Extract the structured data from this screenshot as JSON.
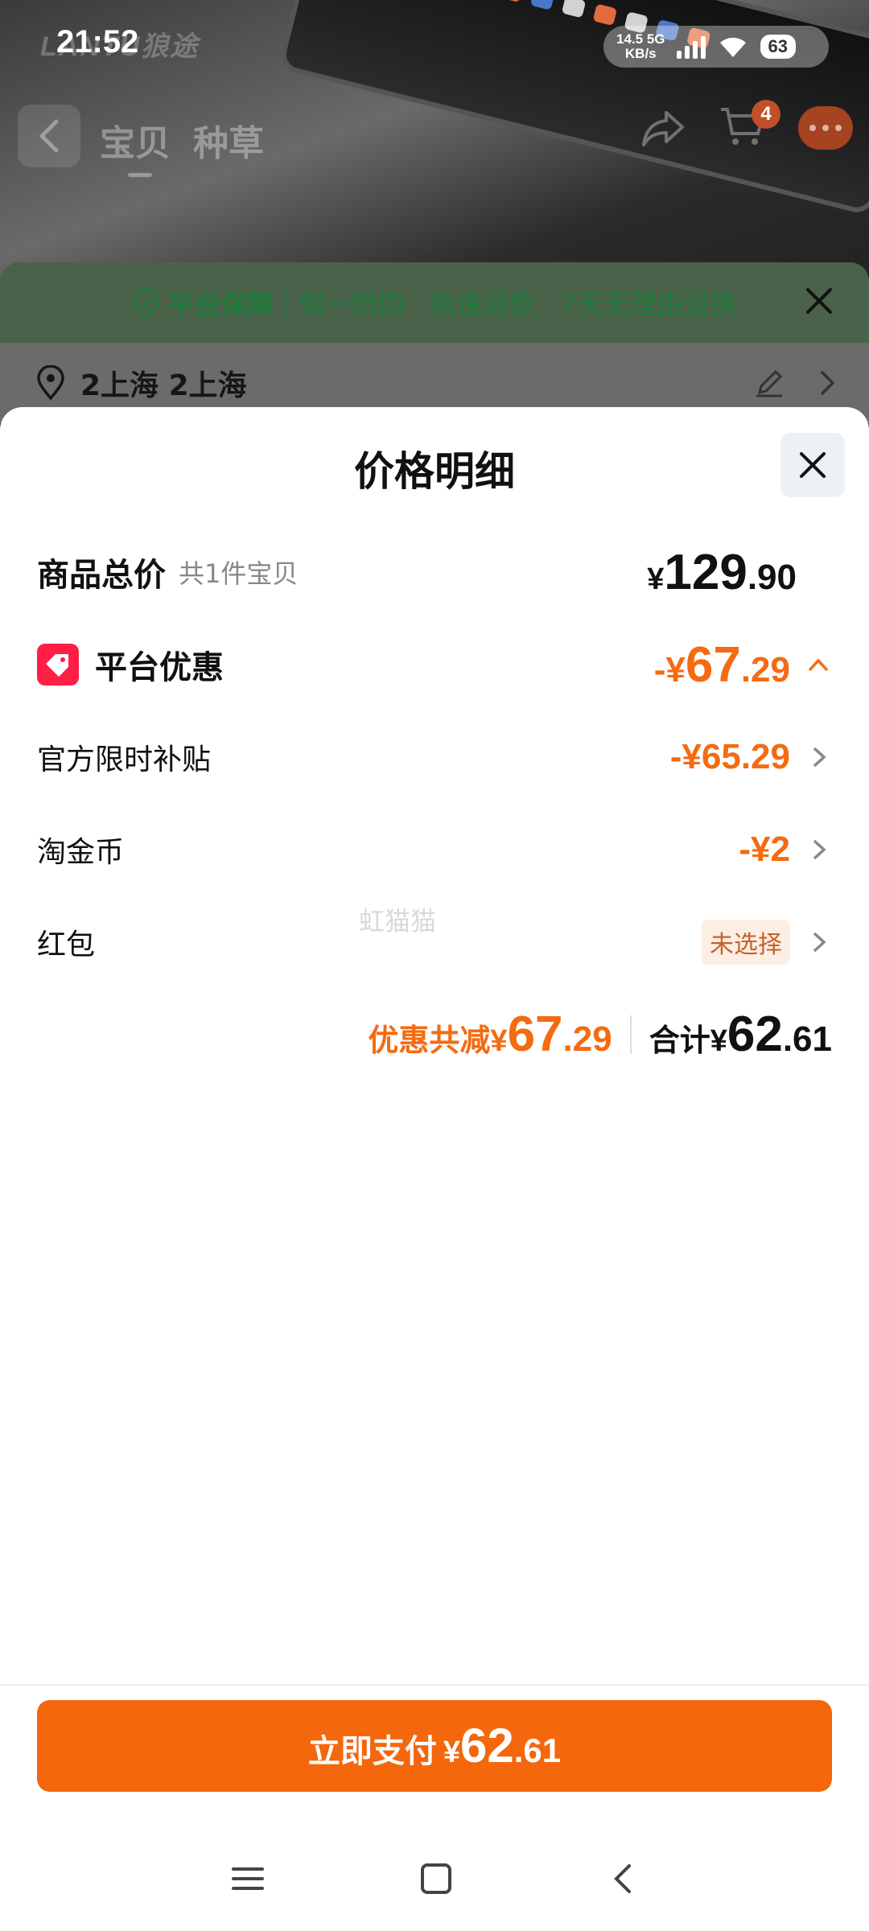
{
  "status_bar": {
    "time": "21:52",
    "net_speed_value": "14.5",
    "net_speed_unit": "KB/s",
    "network": "5G",
    "battery": "63"
  },
  "background": {
    "watermark_text": "LANTU狼途",
    "tabs": [
      "宝贝",
      "种草"
    ],
    "cart_badge": "4",
    "guarantee": {
      "title": "平台保障",
      "items": [
        "假一赔四",
        "极速退款",
        "7天无理由退换"
      ]
    },
    "address": "2上海 2上海"
  },
  "sheet": {
    "title": "价格明细",
    "total": {
      "label": "商品总价",
      "sub": "共1件宝贝",
      "yen": "¥",
      "int": "129",
      "dec": ".90"
    },
    "platform_discount": {
      "label": "平台优惠",
      "prefix": "-¥",
      "int": "67",
      "dec": ".29"
    },
    "subsidy": {
      "label": "官方限时补贴",
      "value": "-¥65.29"
    },
    "coins": {
      "label": "淘金币",
      "value": "-¥2"
    },
    "red_packet": {
      "label": "红包",
      "value": "未选择"
    },
    "watermark": "虹猫猫",
    "summary": {
      "discount_label": "优惠共减",
      "discount_yen": "¥",
      "discount_int": "67",
      "discount_dec": ".29",
      "total_label": "合计",
      "total_yen": "¥",
      "total_int": "62",
      "total_dec": ".61"
    },
    "pay_button": {
      "label": "立即支付",
      "yen": "¥",
      "int": "62",
      "dec": ".61"
    }
  },
  "colors": {
    "accent": "#f46b12",
    "pay_button": "#f4670c",
    "tag_red": "#ff1e46",
    "guarantee_green": "#1e7a3a"
  }
}
